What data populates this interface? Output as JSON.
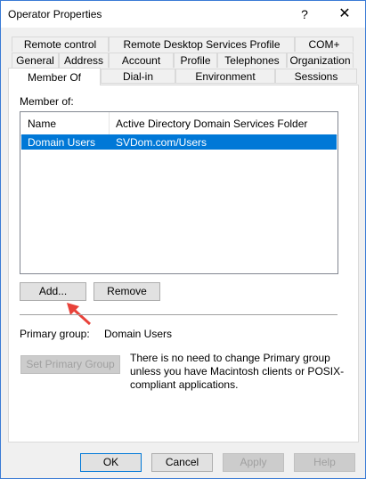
{
  "window": {
    "title": "Operator Properties",
    "help_glyph": "?",
    "close_glyph": "✕"
  },
  "tabs": {
    "row1": [
      "Remote control",
      "Remote Desktop Services Profile",
      "COM+"
    ],
    "row2": [
      "General",
      "Address",
      "Account",
      "Profile",
      "Telephones",
      "Organization"
    ],
    "row3": [
      "Member Of",
      "Dial-in",
      "Environment",
      "Sessions"
    ],
    "active": "Member Of"
  },
  "member_of": {
    "label": "Member of:",
    "columns": [
      "Name",
      "Active Directory Domain Services Folder"
    ],
    "rows": [
      {
        "name": "Domain Users",
        "folder": "SVDom.com/Users"
      }
    ],
    "add_label": "Add...",
    "remove_label": "Remove"
  },
  "primary_group": {
    "label": "Primary group:",
    "value": "Domain Users",
    "set_button": "Set Primary Group",
    "note": "There is no need to change Primary group unless you have Macintosh clients or POSIX-compliant applications."
  },
  "footer": {
    "ok": "OK",
    "cancel": "Cancel",
    "apply": "Apply",
    "help": "Help"
  },
  "colors": {
    "selection": "#0078d7",
    "arrow": "#e8423a"
  }
}
